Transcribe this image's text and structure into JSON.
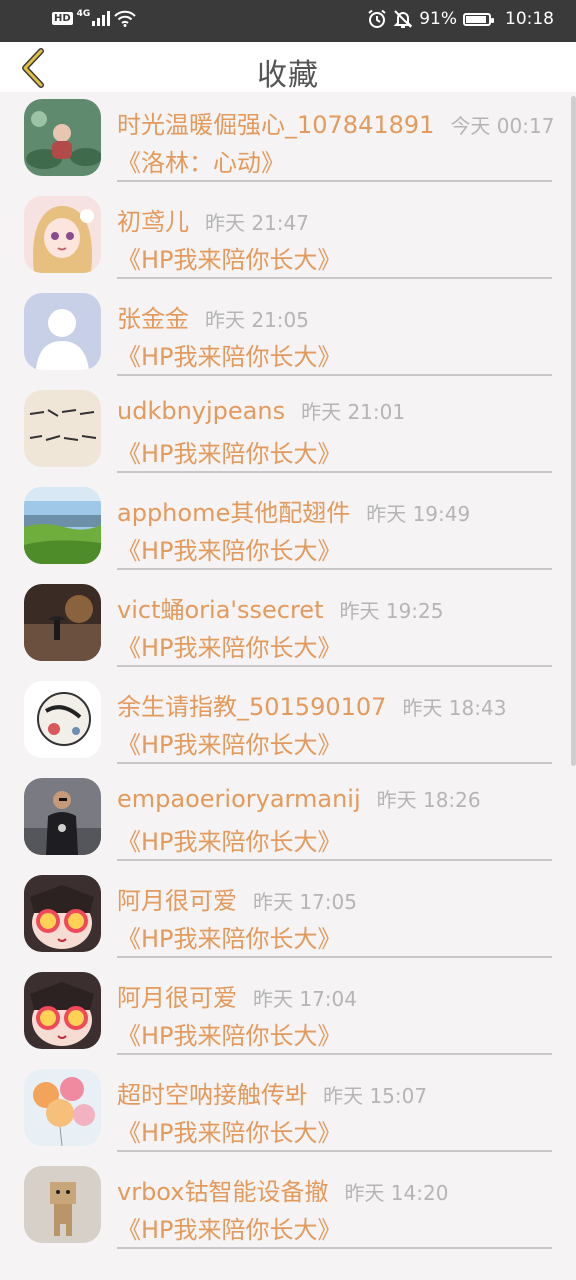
{
  "status_bar": {
    "hd": "HD",
    "network": "4G",
    "battery_percent": "91%",
    "battery_level": 0.91,
    "time": "10:18",
    "icons": [
      "signal-icon",
      "wifi-icon",
      "alarm-icon",
      "bell-off-icon",
      "battery-icon"
    ]
  },
  "header": {
    "title": "收藏",
    "back_icon": "chevron-left-icon",
    "accent": "#e0c040"
  },
  "colors": {
    "name_text": "#e39a5d",
    "time_text": "#b5b5b5",
    "background": "#f5f3f3"
  },
  "items": [
    {
      "name": "时光温暖倔强心_107841891",
      "time": "今天 00:17",
      "fic": "《洛林：心动》",
      "avatar": "photo-avatar-lotus"
    },
    {
      "name": "初鸢儿",
      "time": "昨天 21:47",
      "fic": "《HP我来陪你长大》",
      "avatar": "anime-girl-avatar"
    },
    {
      "name": "张金金",
      "time": "昨天 21:05",
      "fic": "《HP我来陪你长大》",
      "avatar": "default-avatar"
    },
    {
      "name": "udkbnyjpeans",
      "time": "昨天 21:01",
      "fic": "《HP我来陪你长大》",
      "avatar": "handwriting-avatar"
    },
    {
      "name": "apphome其他配翅件",
      "time": "昨天 19:49",
      "fic": "《HP我来陪你长大》",
      "avatar": "landscape-avatar"
    },
    {
      "name": "vict蛹oria'ssecret",
      "time": "昨天 19:25",
      "fic": "《HP我来陪你长大》",
      "avatar": "rain-street-avatar"
    },
    {
      "name": "余生请指教_501590107",
      "time": "昨天 18:43",
      "fic": "《HP我来陪你长大》",
      "avatar": "ink-painting-avatar"
    },
    {
      "name": "empaoerioryarmanij",
      "time": "昨天 18:26",
      "fic": "《HP我来陪你长大》",
      "avatar": "man-photo-avatar"
    },
    {
      "name": "阿月很可爱",
      "time": "昨天 17:05",
      "fic": "《HP我来陪你长大》",
      "avatar": "cartoon-glasses-avatar"
    },
    {
      "name": "阿月很可爱",
      "time": "昨天 17:04",
      "fic": "《HP我来陪你长大》",
      "avatar": "cartoon-glasses-avatar"
    },
    {
      "name": "超时空呐接触传봐",
      "time": "昨天 15:07",
      "fic": "《HP我来陪你长大》",
      "avatar": "balloons-avatar"
    },
    {
      "name": "vrbox钴智能设备撤",
      "time": "昨天 14:20",
      "fic": "《HP我来陪你长大》",
      "avatar": "box-robot-avatar"
    }
  ]
}
